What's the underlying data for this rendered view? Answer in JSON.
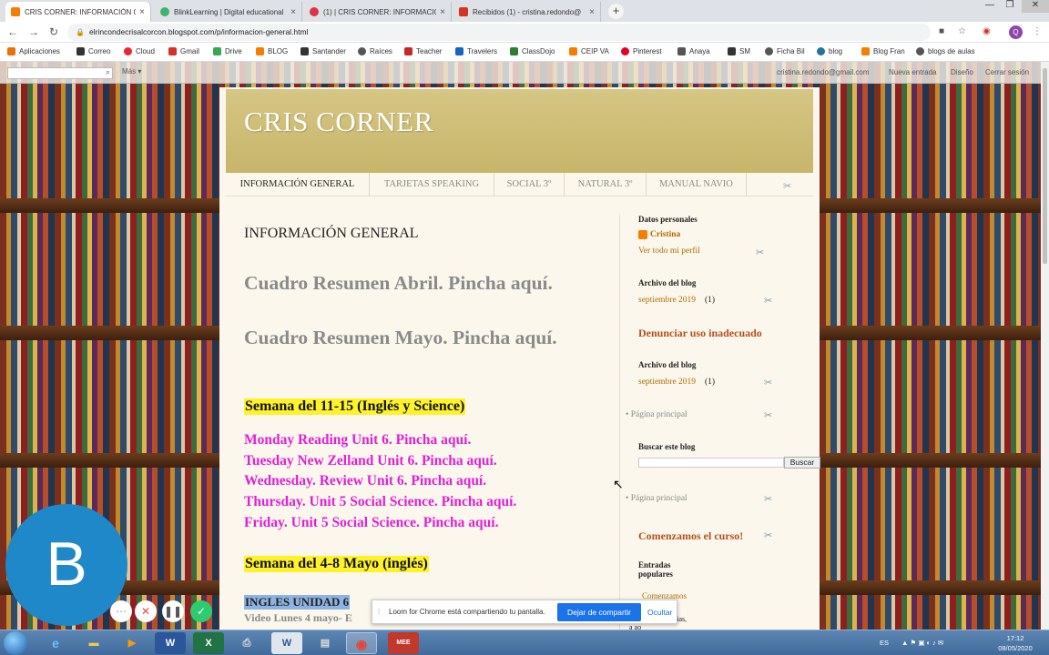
{
  "browser": {
    "tabs": [
      {
        "title": "CRIS CORNER: INFORMACIÓN GENERAL",
        "active": true,
        "favicon_color": "#f57d00"
      },
      {
        "title": "BlinkLearning | Digital educational",
        "active": false,
        "favicon_color": "#3cb371"
      },
      {
        "title": "(1) | CRIS CORNER: INFORMACIÓN",
        "active": false,
        "favicon_color": "#e0304a"
      },
      {
        "title": "Recibidos (1) - cristina.redondo@",
        "active": false,
        "favicon_color": "#d93025"
      }
    ],
    "new_tab": "+",
    "url": "elrincondecrisalcorcon.blogspot.com/p/informacion-general.html",
    "profile_initial": "Q",
    "bookmarks": [
      "Aplicaciones",
      "Correo",
      "Cloud",
      "Gmail",
      "Drive",
      "BLOG",
      "Santander",
      "Raíces",
      "Teacher",
      "Travelers",
      "ClassDojo",
      "CEIP VA",
      "Pinterest",
      "Anaya",
      "SM",
      "Ficha Bil",
      "blog",
      "Blog Fran",
      "blogs de aulas"
    ]
  },
  "blogger_nav": {
    "more": "Más ▾",
    "email": "cristina.redondo@gmail.com",
    "new_post": "Nueva entrada",
    "design": "Diseño",
    "logout": "Cerrar sesión"
  },
  "blog": {
    "title": "CRIS CORNER",
    "pages": [
      "INFORMACIÓN GENERAL",
      "TARJETAS SPEAKING",
      "SOCIAL 3º",
      "NATURAL 3º",
      "MANUAL NAVIO"
    ]
  },
  "post": {
    "title": "INFORMACIÓN GENERAL",
    "summary_links": [
      "Cuadro Resumen Abril. Pincha aquí.",
      "Cuadro Resumen Mayo. Pincha aquí."
    ],
    "week1_heading": "Semana del 11-15 (Inglés y Science)",
    "week1_items": [
      "Monday Reading Unit 6. Pincha aquí.",
      "Tuesday New Zelland Unit 6. Pincha aquí.",
      "Wednesday. Review Unit 6. Pincha aquí.",
      "Thursday. Unit 5 Social Science. Pincha aquí.",
      "Friday. Unit 5 Social Science. Pincha aquí."
    ],
    "week2_heading": "Semana del 4-8 Mayo (inglés)",
    "unit_label": "INGLES UNIDAD 6",
    "video_line": "Video Lunes 4 mayo- E"
  },
  "sidebar": {
    "profile_heading": "Datos personales",
    "profile_name": "Cristina",
    "profile_link": "Ver todo mi perfil",
    "archive_heading": "Archivo del blog",
    "archive_entry": "septiembre 2019",
    "archive_count": "(1)",
    "report": "Denunciar uso inadecuado",
    "archive2_heading": "Archivo del blog",
    "archive2_entry": "septiembre 2019",
    "archive2_count": "(1)",
    "home1": "• Página principal",
    "search_heading": "Buscar este blog",
    "search_button": "Buscar",
    "home2": "• Página principal",
    "start_course": "Comenzamos el curso!",
    "popular_heading": "Entradas populares",
    "popular_item": "Comenzamos el curso!",
    "popular_snip": "Estimados familias, a ao"
  },
  "loom": {
    "avatar_letter": "B",
    "share_text": "Loom for Chrome está compartiendo tu pantalla.",
    "stop_button": "Dejar de compartir",
    "hide_button": "Ocultar"
  },
  "taskbar": {
    "apps": [
      "IE",
      "Explorer",
      "Media",
      "Word",
      "Excel",
      "Printer",
      "Writer",
      "Notes",
      "Chrome",
      "MEE"
    ],
    "lang": "ES",
    "time": "17:12",
    "date": "08/05/2020"
  }
}
